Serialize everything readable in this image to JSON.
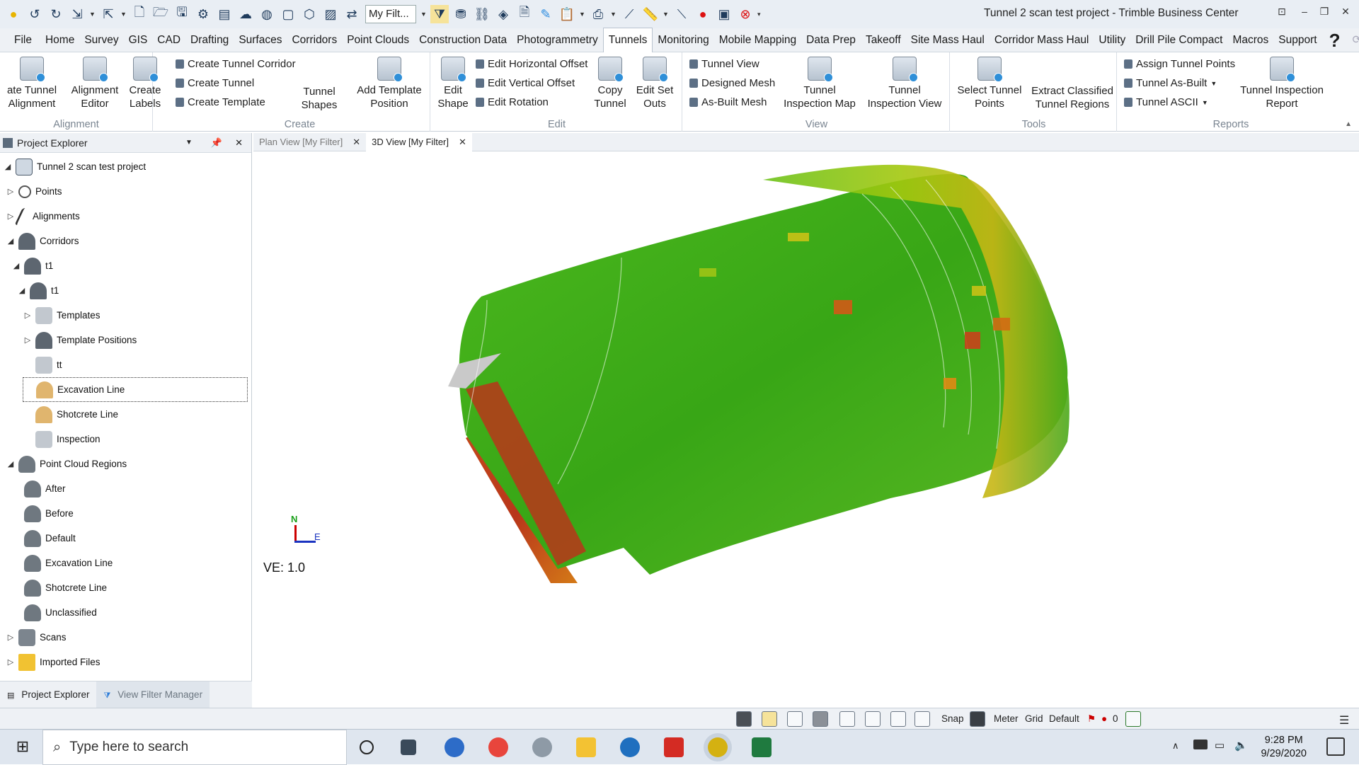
{
  "window": {
    "title": "Tunnel 2 scan test project - Trimble Business Center",
    "filter_select": "My Filt...",
    "controls": [
      "⊡",
      "–",
      "❐",
      "✕"
    ]
  },
  "menu": {
    "tabs": [
      "File",
      "Home",
      "Survey",
      "GIS",
      "CAD",
      "Drafting",
      "Surfaces",
      "Corridors",
      "Point Clouds",
      "Construction Data",
      "Photogrammetry",
      "Tunnels",
      "Monitoring",
      "Mobile Mapping",
      "Data Prep",
      "Takeoff",
      "Site Mass Haul",
      "Corridor Mass Haul",
      "Utility",
      "Drill Pile Compact",
      "Macros",
      "Support"
    ],
    "active": "Tunnels"
  },
  "ribbon": {
    "alignment": {
      "label": "Alignment",
      "create_tunnel_alignment": "ate Tunnel Alignment",
      "alignment_editor": "Alignment Editor",
      "create_labels": "Create Labels"
    },
    "create": {
      "label": "Create",
      "create_tunnel_corridor": "Create Tunnel Corridor",
      "create_tunnel": "Create Tunnel",
      "create_template": "Create Template",
      "tunnel_shapes": "Tunnel Shapes",
      "add_template_position": "Add Template Position"
    },
    "edit": {
      "label": "Edit",
      "edit_shape": "Edit Shape",
      "edit_horizontal_offset": "Edit Horizontal Offset",
      "edit_vertical_offset": "Edit Vertical Offset",
      "edit_rotation": "Edit Rotation",
      "copy_tunnel": "Copy Tunnel",
      "edit_set_outs": "Edit Set Outs"
    },
    "view": {
      "label": "View",
      "tunnel_view": "Tunnel View",
      "designed_mesh": "Designed Mesh",
      "as_built_mesh": "As-Built Mesh",
      "tunnel_inspection_map": "Tunnel Inspection Map",
      "tunnel_inspection_view": "Tunnel Inspection View"
    },
    "tools": {
      "label": "Tools",
      "select_tunnel_points": "Select Tunnel Points",
      "extract_classified": "Extract Classified Tunnel Regions"
    },
    "reports": {
      "label": "Reports",
      "assign_tunnel_points": "Assign Tunnel Points",
      "tunnel_as_built": "Tunnel As-Built",
      "tunnel_ascii": "Tunnel ASCII",
      "tunnel_inspection_report": "Tunnel Inspection Report"
    }
  },
  "project_explorer": {
    "title": "Project Explorer",
    "items": [
      {
        "label": "Tunnel 2 scan test project",
        "toggle": "◢",
        "icon": "project"
      },
      {
        "label": "Points",
        "toggle": "▷",
        "icon": "points"
      },
      {
        "label": "Alignments",
        "toggle": "▷",
        "icon": "alignment"
      },
      {
        "label": "Corridors",
        "toggle": "◢",
        "icon": "corridor"
      },
      {
        "label": "t1",
        "toggle": "◢",
        "icon": "tunnel"
      },
      {
        "label": "t1",
        "toggle": "◢",
        "icon": "tunnel"
      },
      {
        "label": "Templates",
        "toggle": "▷",
        "icon": "template"
      },
      {
        "label": "Template Positions",
        "toggle": "▷",
        "icon": "template-position"
      },
      {
        "label": "tt",
        "toggle": "",
        "icon": "template"
      },
      {
        "label": "Excavation Line",
        "toggle": "",
        "icon": "excavation"
      },
      {
        "label": "Shotcrete Line",
        "toggle": "",
        "icon": "shotcrete"
      },
      {
        "label": "Inspection",
        "toggle": "",
        "icon": "inspection"
      },
      {
        "label": "Point Cloud Regions",
        "toggle": "◢",
        "icon": "cloud"
      },
      {
        "label": "After",
        "toggle": "",
        "icon": "cloud"
      },
      {
        "label": "Before",
        "toggle": "",
        "icon": "cloud"
      },
      {
        "label": "Default",
        "toggle": "",
        "icon": "cloud"
      },
      {
        "label": "Excavation Line",
        "toggle": "",
        "icon": "cloud"
      },
      {
        "label": "Shotcrete Line",
        "toggle": "",
        "icon": "cloud"
      },
      {
        "label": "Unclassified",
        "toggle": "",
        "icon": "cloud"
      },
      {
        "label": "Scans",
        "toggle": "▷",
        "icon": "scans"
      },
      {
        "label": "Imported Files",
        "toggle": "▷",
        "icon": "folder"
      }
    ],
    "footer_tabs": [
      "Project Explorer",
      "View Filter Manager"
    ]
  },
  "document_tabs": [
    {
      "label": "Plan View [My Filter]",
      "close": "✕"
    },
    {
      "label": "3D View [My Filter]",
      "close": "✕"
    }
  ],
  "viewport": {
    "ve_label": "VE: 1.0",
    "north_label": "N",
    "east_label": "E",
    "mesh_colors": [
      "#3fae1c",
      "#7cc70f",
      "#c9cc16",
      "#d96b13",
      "#b8361a"
    ]
  },
  "statusbar": {
    "snap": "Snap",
    "units": "Meter",
    "grid": "Grid",
    "layer": "Default",
    "count": "0"
  },
  "taskbar": {
    "search_placeholder": "Type here to search",
    "time": "9:28 PM",
    "date": "9/29/2020"
  }
}
